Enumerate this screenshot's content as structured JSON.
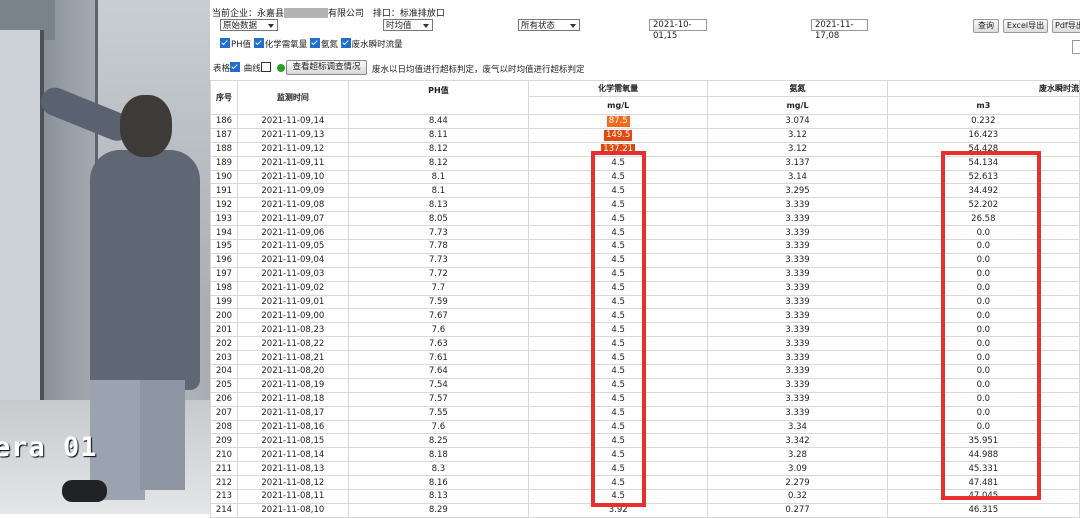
{
  "camera": {
    "label": "era 01"
  },
  "header": {
    "crumb_prefix": "当前企业：永嘉县",
    "crumb_suffix": "有限公司",
    "outlet_label": "排口：标准排放口"
  },
  "toolbar": {
    "data_type": "原始数据",
    "aggregation": "时均值",
    "status": "所有状态",
    "start_date": "2021-10-01,15",
    "end_date": "2021-11-17,08",
    "query": "查询",
    "excel": "Excel导出",
    "pdf": "Pdf导出"
  },
  "filters": {
    "ph": "PH值",
    "cod": "化学需氧量",
    "ammonia": "氨氮",
    "flow": "废水瞬时流量"
  },
  "options": {
    "table": "表格",
    "curve": "曲线",
    "exceed_button": "查看超标调查情况",
    "note": "废水以日均值进行超标判定，废气以时均值进行超标判定"
  },
  "table": {
    "headers": {
      "index": "序号",
      "time": "监测时间",
      "ph": "PH值",
      "cod": "化学需氧量",
      "ammonia": "氨氮",
      "flow": "废水瞬时流"
    },
    "units": {
      "cod": "mg/L",
      "ammonia": "mg/L",
      "flow": "m3"
    },
    "rows": [
      {
        "n": "186",
        "t": "2021-11-09,14",
        "ph": "8.44",
        "cod": "87.5",
        "nh": "3.074",
        "flow": "0.232",
        "over": true
      },
      {
        "n": "187",
        "t": "2021-11-09,13",
        "ph": "8.11",
        "cod": "149.5",
        "nh": "3.12",
        "flow": "16.423",
        "over": true
      },
      {
        "n": "188",
        "t": "2021-11-09,12",
        "ph": "8.12",
        "cod": "137.21",
        "nh": "3.12",
        "flow": "54.428",
        "over": true
      },
      {
        "n": "189",
        "t": "2021-11-09,11",
        "ph": "8.12",
        "cod": "4.5",
        "nh": "3.137",
        "flow": "54.134"
      },
      {
        "n": "190",
        "t": "2021-11-09,10",
        "ph": "8.1",
        "cod": "4.5",
        "nh": "3.14",
        "flow": "52.613"
      },
      {
        "n": "191",
        "t": "2021-11-09,09",
        "ph": "8.1",
        "cod": "4.5",
        "nh": "3.295",
        "flow": "34.492"
      },
      {
        "n": "192",
        "t": "2021-11-09,08",
        "ph": "8.13",
        "cod": "4.5",
        "nh": "3.339",
        "flow": "52.202"
      },
      {
        "n": "193",
        "t": "2021-11-09,07",
        "ph": "8.05",
        "cod": "4.5",
        "nh": "3.339",
        "flow": "26.58"
      },
      {
        "n": "194",
        "t": "2021-11-09,06",
        "ph": "7.73",
        "cod": "4.5",
        "nh": "3.339",
        "flow": "0.0"
      },
      {
        "n": "195",
        "t": "2021-11-09,05",
        "ph": "7.78",
        "cod": "4.5",
        "nh": "3.339",
        "flow": "0.0"
      },
      {
        "n": "196",
        "t": "2021-11-09,04",
        "ph": "7.73",
        "cod": "4.5",
        "nh": "3.339",
        "flow": "0.0"
      },
      {
        "n": "197",
        "t": "2021-11-09,03",
        "ph": "7.72",
        "cod": "4.5",
        "nh": "3.339",
        "flow": "0.0"
      },
      {
        "n": "198",
        "t": "2021-11-09,02",
        "ph": "7.7",
        "cod": "4.5",
        "nh": "3.339",
        "flow": "0.0"
      },
      {
        "n": "199",
        "t": "2021-11-09,01",
        "ph": "7.59",
        "cod": "4.5",
        "nh": "3.339",
        "flow": "0.0"
      },
      {
        "n": "200",
        "t": "2021-11-09,00",
        "ph": "7.67",
        "cod": "4.5",
        "nh": "3.339",
        "flow": "0.0"
      },
      {
        "n": "201",
        "t": "2021-11-08,23",
        "ph": "7.6",
        "cod": "4.5",
        "nh": "3.339",
        "flow": "0.0"
      },
      {
        "n": "202",
        "t": "2021-11-08,22",
        "ph": "7.63",
        "cod": "4.5",
        "nh": "3.339",
        "flow": "0.0"
      },
      {
        "n": "203",
        "t": "2021-11-08,21",
        "ph": "7.61",
        "cod": "4.5",
        "nh": "3.339",
        "flow": "0.0"
      },
      {
        "n": "204",
        "t": "2021-11-08,20",
        "ph": "7.64",
        "cod": "4.5",
        "nh": "3.339",
        "flow": "0.0"
      },
      {
        "n": "205",
        "t": "2021-11-08,19",
        "ph": "7.54",
        "cod": "4.5",
        "nh": "3.339",
        "flow": "0.0"
      },
      {
        "n": "206",
        "t": "2021-11-08,18",
        "ph": "7.57",
        "cod": "4.5",
        "nh": "3.339",
        "flow": "0.0"
      },
      {
        "n": "207",
        "t": "2021-11-08,17",
        "ph": "7.55",
        "cod": "4.5",
        "nh": "3.339",
        "flow": "0.0"
      },
      {
        "n": "208",
        "t": "2021-11-08,16",
        "ph": "7.6",
        "cod": "4.5",
        "nh": "3.34",
        "flow": "0.0"
      },
      {
        "n": "209",
        "t": "2021-11-08,15",
        "ph": "8.25",
        "cod": "4.5",
        "nh": "3.342",
        "flow": "35.951"
      },
      {
        "n": "210",
        "t": "2021-11-08,14",
        "ph": "8.18",
        "cod": "4.5",
        "nh": "3.28",
        "flow": "44.988"
      },
      {
        "n": "211",
        "t": "2021-11-08,13",
        "ph": "8.3",
        "cod": "4.5",
        "nh": "3.09",
        "flow": "45.331"
      },
      {
        "n": "212",
        "t": "2021-11-08,12",
        "ph": "8.16",
        "cod": "4.5",
        "nh": "2.279",
        "flow": "47.481"
      },
      {
        "n": "213",
        "t": "2021-11-08,11",
        "ph": "8.13",
        "cod": "4.5",
        "nh": "0.32",
        "flow": "47.045"
      },
      {
        "n": "214",
        "t": "2021-11-08,10",
        "ph": "8.29",
        "cod": "3.92",
        "nh": "0.277",
        "flow": "46.315"
      }
    ]
  },
  "colors": {
    "exceed": "#f26b1c",
    "highlight_box": "#e63030",
    "checkbox": "#1f6fd1"
  }
}
